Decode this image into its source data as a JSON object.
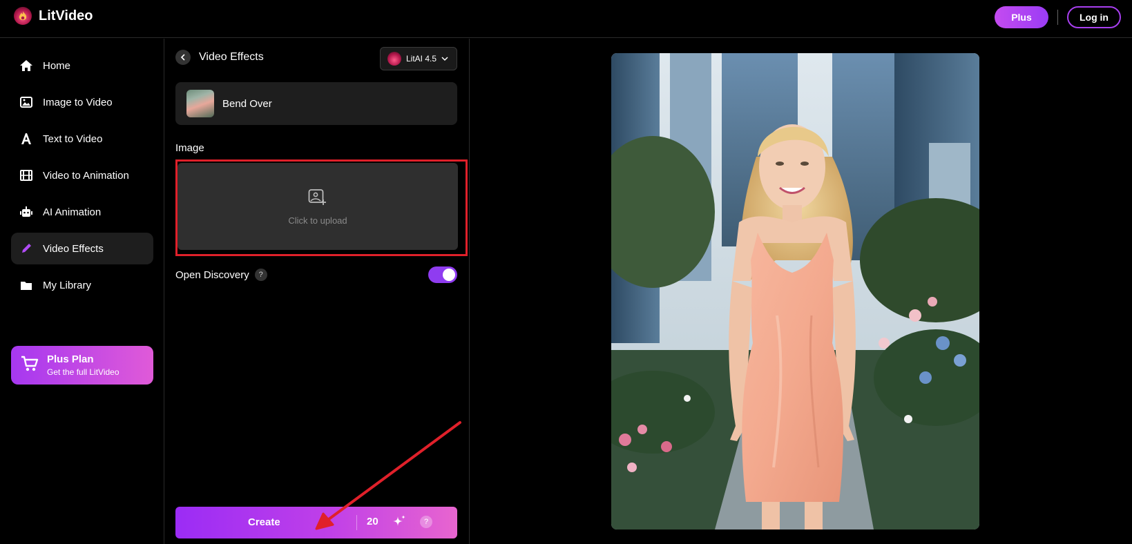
{
  "app": {
    "name": "LitVideo"
  },
  "header": {
    "plus_label": "Plus",
    "login_label": "Log in"
  },
  "sidebar": {
    "items": [
      {
        "label": "Home",
        "icon": "home-icon"
      },
      {
        "label": "Image to Video",
        "icon": "image-icon"
      },
      {
        "label": "Text to Video",
        "icon": "text-icon"
      },
      {
        "label": "Video to Animation",
        "icon": "film-icon"
      },
      {
        "label": "AI Animation",
        "icon": "robot-icon"
      },
      {
        "label": "Video Effects",
        "icon": "pencil-icon",
        "active": true
      },
      {
        "label": "My Library",
        "icon": "folder-icon"
      }
    ],
    "promo": {
      "title": "Plus Plan",
      "subtitle": "Get the full LitVideo",
      "icon": "cart-icon"
    }
  },
  "panel": {
    "title": "Video Effects",
    "model": {
      "label": "LitAI 4.5"
    },
    "effect": {
      "name": "Bend Over"
    },
    "image_section": {
      "label": "Image",
      "upload_text": "Click to upload"
    },
    "discovery": {
      "label": "Open Discovery",
      "help": "?",
      "enabled": true
    },
    "create": {
      "label": "Create",
      "credits": "20",
      "help": "?"
    }
  },
  "colors": {
    "accent": "#9b3cf5",
    "accent_pink": "#e05ad8",
    "highlight_red": "#e0202a"
  }
}
